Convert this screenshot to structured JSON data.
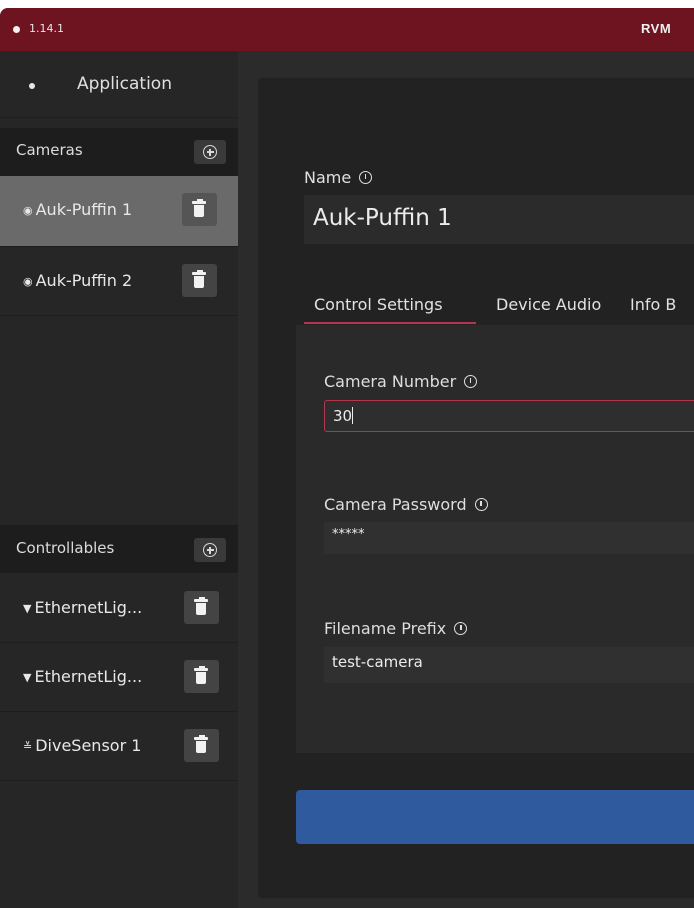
{
  "titlebar": {
    "version": "1.14.1",
    "app_name": "RVM"
  },
  "sidebar": {
    "application_label": "Application",
    "cameras": {
      "header": "Cameras",
      "items": [
        {
          "icon": "camera-icon",
          "label": "Auk-Puffin 1",
          "selected": true
        },
        {
          "icon": "camera-icon",
          "label": "Auk-Puffin 2",
          "selected": false
        }
      ]
    },
    "controllables": {
      "header": "Controllables",
      "items": [
        {
          "icon": "light-icon",
          "label": "EthernetLig..."
        },
        {
          "icon": "light-icon",
          "label": "EthernetLig..."
        },
        {
          "icon": "sensor-icon",
          "label": "DiveSensor 1"
        }
      ]
    }
  },
  "main": {
    "name_label": "Name",
    "name_value": "Auk-Puffin 1",
    "tabs": [
      {
        "label": "Control Settings",
        "active": true
      },
      {
        "label": "Device Audio",
        "active": false
      },
      {
        "label": "Info B",
        "active": false
      }
    ],
    "fields": {
      "camera_number": {
        "label": "Camera Number",
        "value": "30"
      },
      "camera_password": {
        "label": "Camera Password",
        "value": "*****"
      },
      "filename_prefix": {
        "label": "Filename Prefix",
        "value": "test-camera"
      }
    }
  },
  "colors": {
    "titlebar": "#6e1420",
    "accent": "#b3364e",
    "primary_button": "#2f5a9e"
  }
}
